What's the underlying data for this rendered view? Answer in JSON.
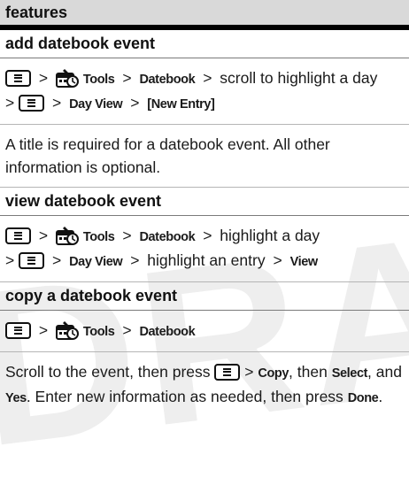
{
  "watermark": "DRAFT",
  "header": {
    "title": "features"
  },
  "sections": {
    "add": {
      "title": "add datebook event",
      "path_tools": "Tools",
      "path_datebook": "Datebook",
      "path_scroll": "scroll to highlight a day",
      "path_dayview": "Day View",
      "path_new_entry": "[New Entry]",
      "note": "A title is required for a datebook event. All other information is optional."
    },
    "view": {
      "title": "view datebook event",
      "path_tools": "Tools",
      "path_datebook": "Datebook",
      "path_highlight_day": "highlight a day",
      "path_dayview": "Day View",
      "path_highlight_entry": "highlight an entry",
      "path_view": "View"
    },
    "copy": {
      "title": "copy a datebook event",
      "path_tools": "Tools",
      "path_datebook": "Datebook",
      "text_scroll": "Scroll to the event, then press",
      "key_copy": "Copy",
      "text_then": ", then",
      "key_select": "Select",
      "text_and": ",",
      "text_and2": "and",
      "key_yes": "Yes",
      "text_enter": ". Enter new information as needed, then press",
      "key_done": "Done",
      "text_end": "."
    }
  },
  "symbols": {
    "gt": ">"
  },
  "icons": {
    "menu": "menu-key-icon",
    "tools": "tools-icon"
  }
}
